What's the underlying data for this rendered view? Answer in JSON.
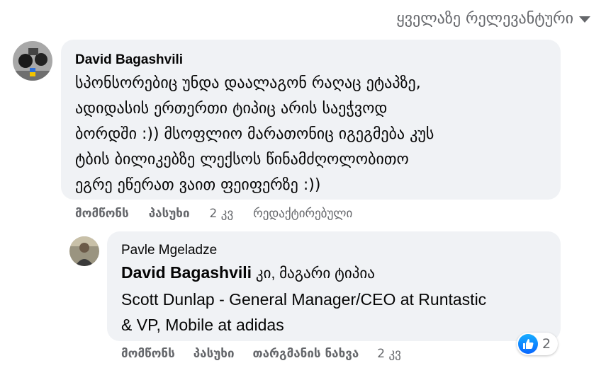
{
  "sort": {
    "label": "ყველაზე რელევანტური"
  },
  "comment": {
    "author": "David Bagashvili",
    "text": "სპონსორებიც უნდა დაალაგონ რაღაც ეტაპზე,\nადიდასის ერთერთი ტიპიც არის საეჭვოდ\nბორდში :)) მსოფლიო მარათონიც იგეგმება კუს\nტბის ბილიკებზე ლექსოს წინამძღოლობითო\nეგრე ეწერათ ვაით ფეიფერზე :))",
    "actions": {
      "like": "მომწონს",
      "reply": "პასუხი",
      "time": "2 კვ",
      "edited": "რედაქტირებული"
    }
  },
  "reply": {
    "author": "Pavle Mgeladze",
    "mention": "David Bagashvili",
    "text_line1": " კი, მაგარი ტიპია",
    "text_line2": "Scott Dunlap - General Manager/CEO at Runtastic\n& VP, Mobile at adidas",
    "actions": {
      "like": "მომწონს",
      "reply": "პასუხი",
      "translate": "თარგმანის ნახვა",
      "time": "2 კვ"
    },
    "reactions": {
      "icon": "like-icon",
      "count": "2"
    }
  },
  "colors": {
    "bubble": "#f0f2f5",
    "secondary": "#65676b",
    "like_blue": "#0866ff"
  }
}
